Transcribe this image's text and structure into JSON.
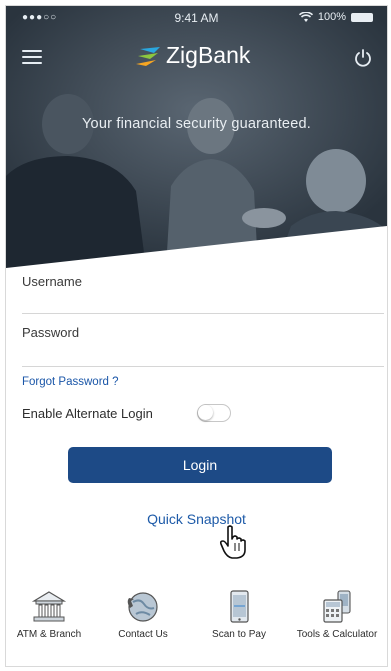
{
  "status_bar": {
    "signal": "●●●○○",
    "time": "9:41 AM",
    "battery": "100%"
  },
  "header": {
    "brand_name": "ZigBank",
    "tagline": "Your financial security guaranteed."
  },
  "form": {
    "username_label": "Username",
    "password_label": "Password",
    "forgot_password": "Forgot Password ?",
    "alternate_login_label": "Enable Alternate Login",
    "alternate_login_enabled": false,
    "login_button": "Login",
    "quick_snapshot": "Quick Snapshot"
  },
  "bottom_nav": [
    {
      "label": "ATM & Branch",
      "icon": "bank-building-icon"
    },
    {
      "label": "Contact Us",
      "icon": "globe-phone-icon"
    },
    {
      "label": "Scan to Pay",
      "icon": "phone-scan-icon"
    },
    {
      "label": "Tools & Calculator",
      "icon": "calculator-icon"
    }
  ],
  "colors": {
    "primary": "#1d4a86",
    "link": "#1a56a8",
    "hero_dark": "#27323d"
  }
}
